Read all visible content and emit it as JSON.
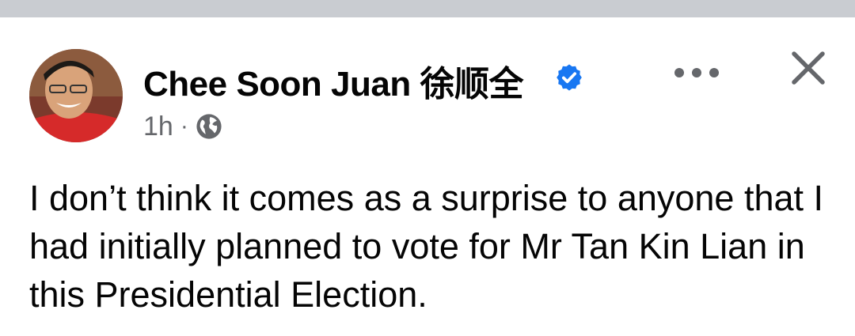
{
  "post": {
    "author_name": "Chee Soon Juan 徐顺全",
    "verified": true,
    "time": "1h",
    "separator": "·",
    "audience_icon": "globe-icon",
    "more_icon": "more-options-icon",
    "close_icon": "close-icon",
    "text": "I don’t think it comes as a surprise to anyone that I had initially planned to vote for Mr Tan Kin Lian in this Presidential Election."
  },
  "colors": {
    "top_bar": "#c9ccd1",
    "verified_badge": "#1877f2",
    "meta_text": "#65676b",
    "body_text": "#050505"
  }
}
